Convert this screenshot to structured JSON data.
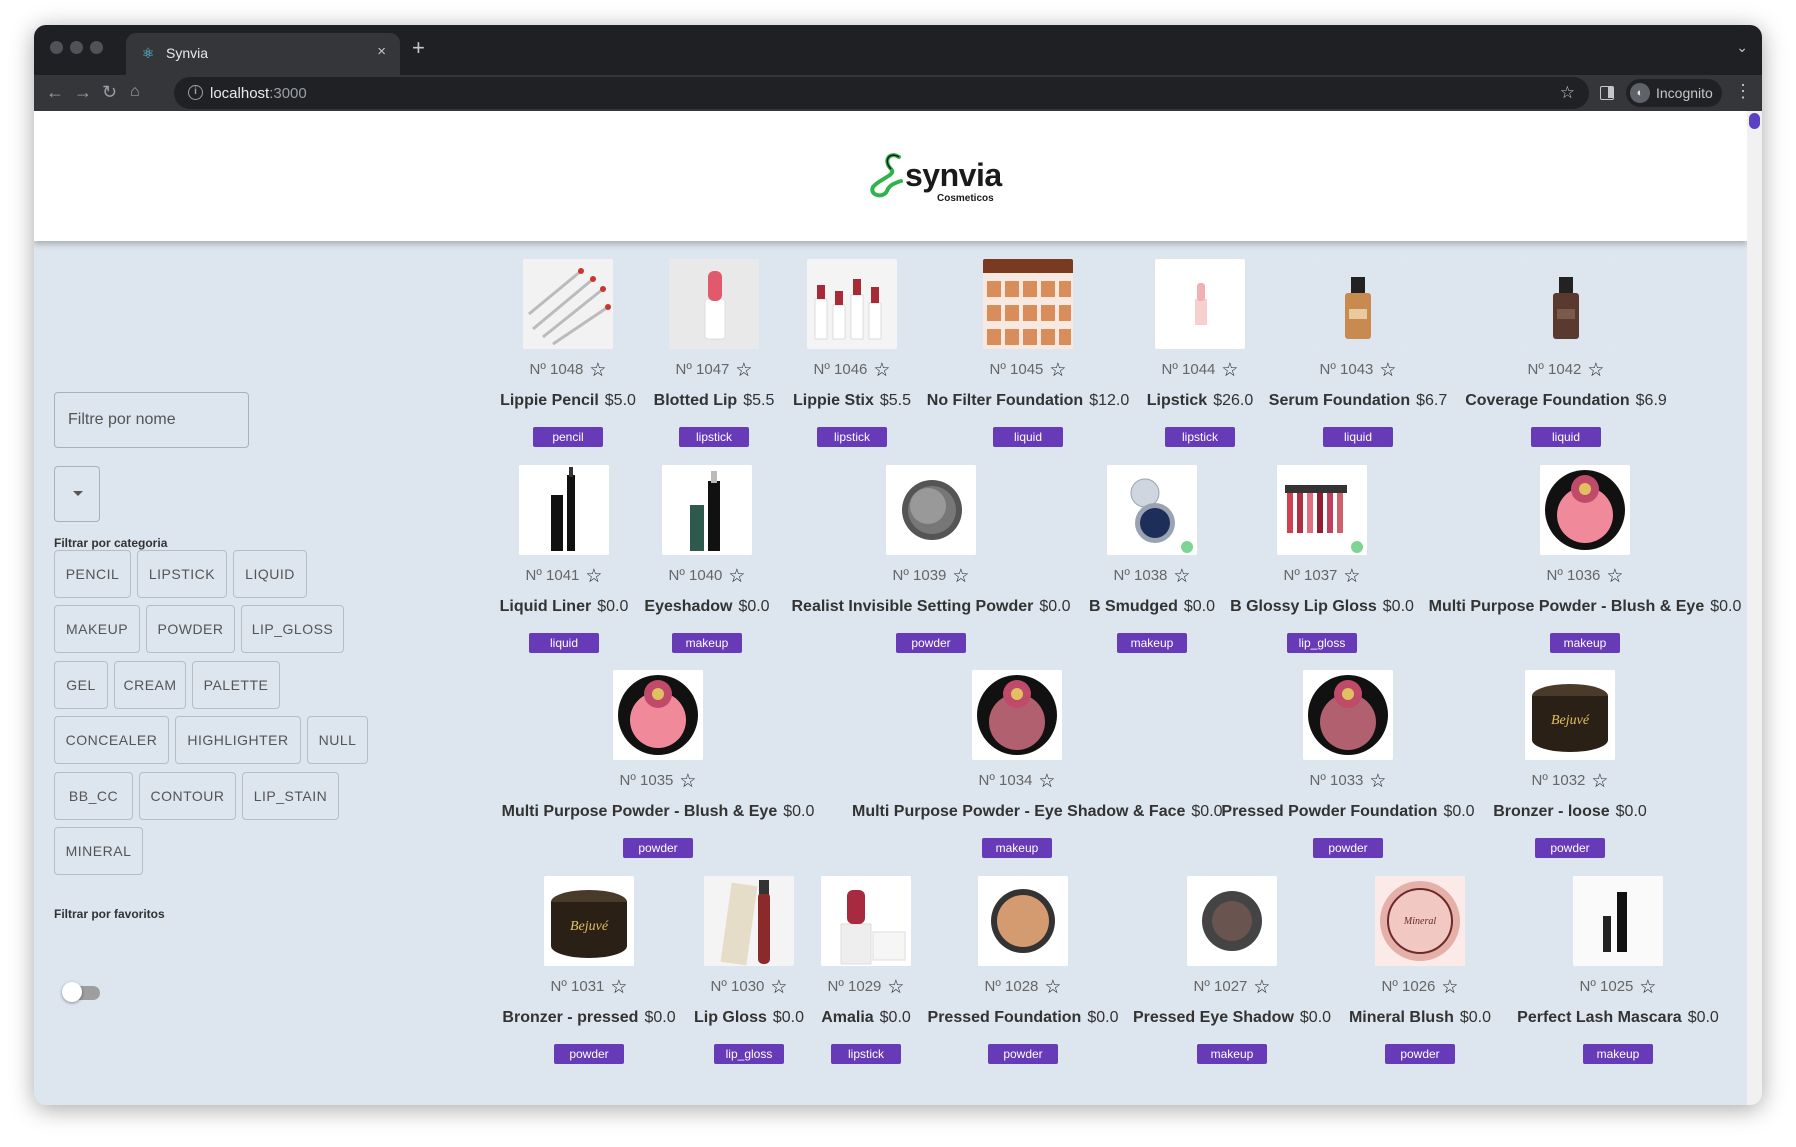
{
  "browser": {
    "tab_title": "Synvia",
    "tab_close": "×",
    "new_tab": "+",
    "url_host": "localhost",
    "url_port": ":3000",
    "incognito_label": "Incognito"
  },
  "header": {
    "logo_text": "synvia",
    "logo_sub": "Cosmeticos"
  },
  "filters": {
    "search_placeholder": "Filtre por nome",
    "category_label": "Filtrar por categoria",
    "favorites_label": "Filtrar por favoritos",
    "categories": [
      "PENCIL",
      "LIPSTICK",
      "LIQUID",
      "MAKEUP",
      "POWDER",
      "LIP_GLOSS",
      "GEL",
      "CREAM",
      "PALETTE",
      "CONCEALER",
      "HIGHLIGHTER",
      "NULL",
      "BB_CC",
      "CONTOUR",
      "LIP_STAIN",
      "MINERAL"
    ],
    "favorites_on": false
  },
  "colors": {
    "accent": "#673ab7",
    "page_bg": "#dde5ee"
  },
  "products": [
    {
      "id": "Nº 1048",
      "name": "Lippie Pencil",
      "price": "$5.0",
      "category": "pencil",
      "thumb": "pencils"
    },
    {
      "id": "Nº 1047",
      "name": "Blotted Lip",
      "price": "$5.5",
      "category": "lipstick",
      "thumb": "lipstick-pink"
    },
    {
      "id": "Nº 1046",
      "name": "Lippie Stix",
      "price": "$5.5",
      "category": "lipstick",
      "thumb": "lipsticks"
    },
    {
      "id": "Nº 1045",
      "name": "No Filter Foundation",
      "price": "$12.0",
      "category": "liquid",
      "thumb": "foundation-grid"
    },
    {
      "id": "Nº 1044",
      "name": "Lipstick",
      "price": "$26.0",
      "category": "lipstick",
      "thumb": "lipstick-light"
    },
    {
      "id": "Nº 1043",
      "name": "Serum Foundation",
      "price": "$6.7",
      "category": "liquid",
      "thumb": "bottle-light"
    },
    {
      "id": "Nº 1042",
      "name": "Coverage Foundation",
      "price": "$6.9",
      "category": "liquid",
      "thumb": "bottle-dark"
    },
    {
      "id": "Nº 1041",
      "name": "Liquid Liner",
      "price": "$0.0",
      "category": "liquid",
      "thumb": "liner"
    },
    {
      "id": "Nº 1040",
      "name": "Eyeshadow",
      "price": "$0.0",
      "category": "makeup",
      "thumb": "liner-green"
    },
    {
      "id": "Nº 1039",
      "name": "Realist Invisible Setting Powder",
      "price": "$0.0",
      "category": "powder",
      "thumb": "powder-tin"
    },
    {
      "id": "Nº 1038",
      "name": "B Smudged",
      "price": "$0.0",
      "category": "makeup",
      "thumb": "shadow-blue"
    },
    {
      "id": "Nº 1037",
      "name": "B Glossy Lip Gloss",
      "price": "$0.0",
      "category": "lip_gloss",
      "thumb": "gloss-set"
    },
    {
      "id": "Nº 1036",
      "name": "Multi Purpose Powder - Blush & Eye",
      "price": "$0.0",
      "category": "makeup",
      "thumb": "blush-pink"
    },
    {
      "id": "Nº 1035",
      "name": "Multi Purpose Powder - Blush & Eye",
      "price": "$0.0",
      "category": "powder",
      "thumb": "blush-pink"
    },
    {
      "id": "Nº 1034",
      "name": "Multi Purpose Powder - Eye Shadow & Face",
      "price": "$0.0",
      "category": "makeup",
      "thumb": "blush-mauve"
    },
    {
      "id": "Nº 1033",
      "name": "Pressed Powder Foundation",
      "price": "$0.0",
      "category": "powder",
      "thumb": "blush-mauve"
    },
    {
      "id": "Nº 1032",
      "name": "Bronzer - loose",
      "price": "$0.0",
      "category": "powder",
      "thumb": "jar"
    },
    {
      "id": "Nº 1031",
      "name": "Bronzer - pressed",
      "price": "$0.0",
      "category": "powder",
      "thumb": "jar"
    },
    {
      "id": "Nº 1030",
      "name": "Lip Gloss",
      "price": "$0.0",
      "category": "lip_gloss",
      "thumb": "gloss-tube"
    },
    {
      "id": "Nº 1029",
      "name": "Amalia",
      "price": "$0.0",
      "category": "lipstick",
      "thumb": "lipstick-red"
    },
    {
      "id": "Nº 1028",
      "name": "Pressed Foundation",
      "price": "$0.0",
      "category": "powder",
      "thumb": "compact"
    },
    {
      "id": "Nº 1027",
      "name": "Pressed Eye Shadow",
      "price": "$0.0",
      "category": "makeup",
      "thumb": "shadow-brown"
    },
    {
      "id": "Nº 1026",
      "name": "Mineral Blush",
      "price": "$0.0",
      "category": "powder",
      "thumb": "mineral"
    },
    {
      "id": "Nº 1025",
      "name": "Perfect Lash Mascara",
      "price": "$0.0",
      "category": "makeup",
      "thumb": "mascara"
    }
  ]
}
